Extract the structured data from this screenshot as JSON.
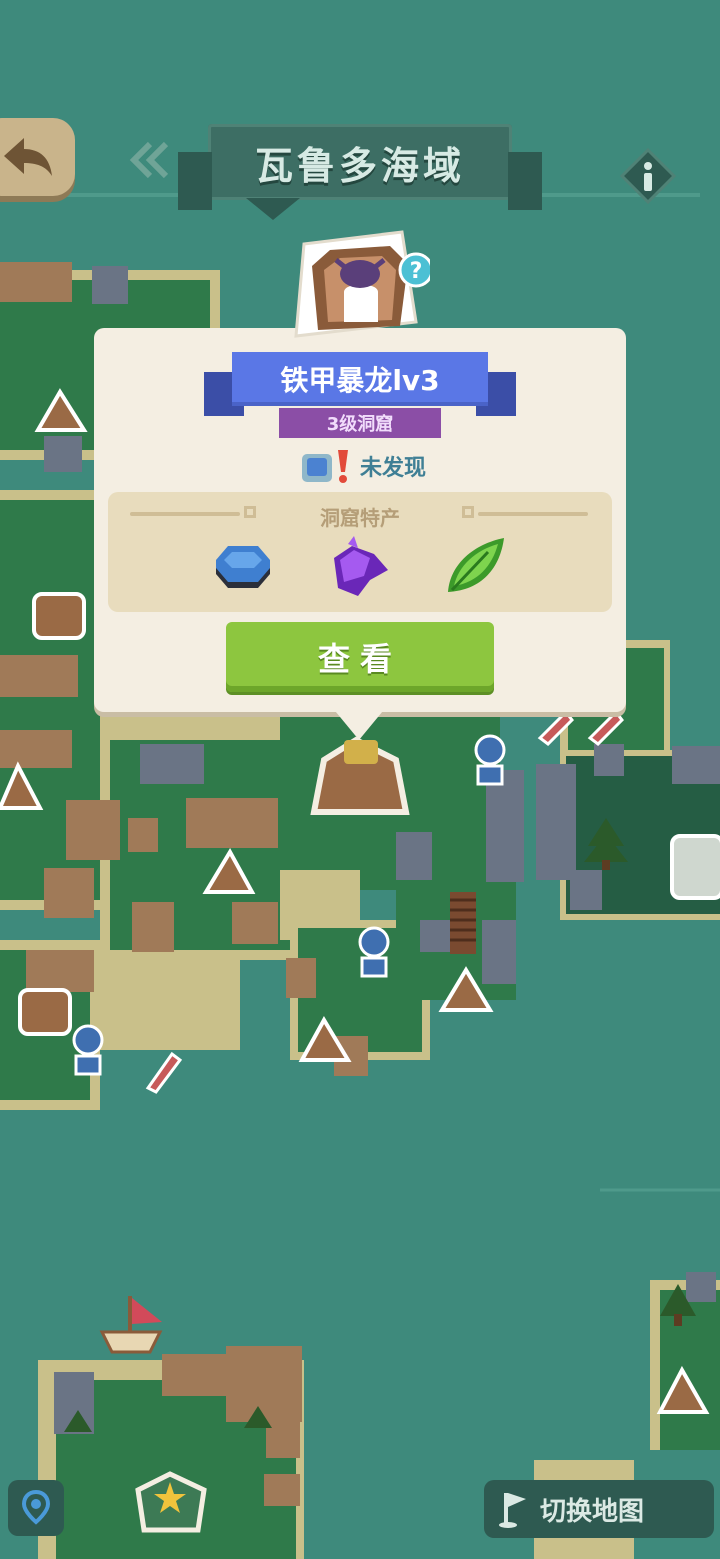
{
  "header": {
    "back_icon": "back-arrow-icon",
    "title": "瓦鲁多海域",
    "info_icon": "info-icon"
  },
  "popup": {
    "monster_name": "铁甲暴龙lv3",
    "cave_level": "3级洞窟",
    "status_text": "未发现",
    "products_title": "洞窟特产",
    "products": [
      {
        "icon": "blue-ore-icon",
        "color": "#3f7fd0"
      },
      {
        "icon": "purple-crystal-icon",
        "color": "#8a3ee0"
      },
      {
        "icon": "green-leaf-icon",
        "color": "#5bbf3a"
      }
    ],
    "view_button": "查看"
  },
  "footer": {
    "locate_icon": "location-pin-icon",
    "switch_map_label": "切换地图",
    "switch_map_icon": "flag-icon"
  },
  "colors": {
    "sea": "#3e8a7c",
    "land": "#2f7a4a",
    "sand": "#c9c08a",
    "accent_green": "#8dc63f",
    "ribbon_blue": "#5a77e6"
  }
}
